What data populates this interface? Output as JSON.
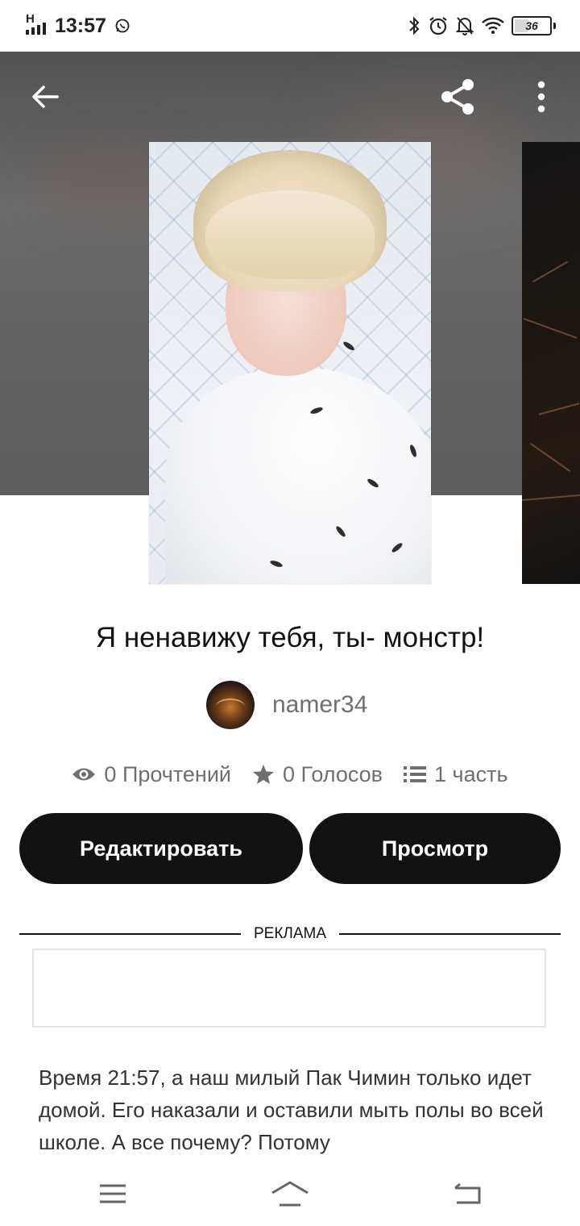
{
  "status_bar": {
    "network_type": "H",
    "time": "13:57",
    "battery_level": "36",
    "icons": [
      "whatsapp-icon",
      "bluetooth-icon",
      "alarm-icon",
      "notifications-off-icon",
      "wifi-icon",
      "battery-icon"
    ]
  },
  "toolbar": {
    "back_icon": "arrow-left-icon",
    "share_icon": "share-icon",
    "more_icon": "more-vertical-icon"
  },
  "story": {
    "title": "Я ненавижу тебя, ты- монстр!",
    "author": "namer34",
    "stats": {
      "reads": "0 Прочтений",
      "votes": "0 Голосов",
      "parts": "1 часть"
    },
    "excerpt": "Время 21:57, а наш милый Пак Чимин только идет домой. Его наказали и оставили мыть полы во всей школе. А все почему? Потому"
  },
  "actions": {
    "edit_label": "Редактировать",
    "preview_label": "Просмотр"
  },
  "ad": {
    "label": "РЕКЛАМА"
  },
  "colors": {
    "button_bg": "#121212",
    "button_text": "#ffffff",
    "muted_text": "#6f6f6f",
    "hero_bg": "#5e5e5e"
  }
}
